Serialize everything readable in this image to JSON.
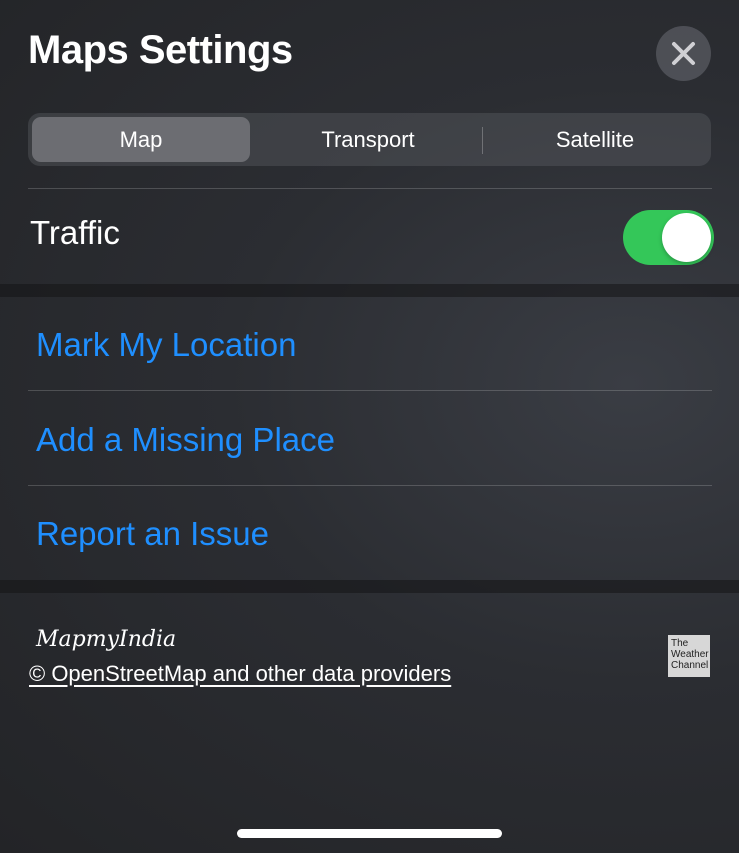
{
  "header": {
    "title": "Maps Settings",
    "close_icon": "close-icon"
  },
  "map_type": {
    "options": [
      "Map",
      "Transport",
      "Satellite"
    ],
    "selected": "Map"
  },
  "traffic": {
    "label": "Traffic",
    "enabled": true,
    "color": "#34c759"
  },
  "actions": [
    "Mark My Location",
    "Add a Missing Place",
    "Report an Issue"
  ],
  "accent_color": "#1f8fff",
  "footer": {
    "mapmyindia": "MapmyIndia",
    "copyright": "© OpenStreetMap and other data providers",
    "weather_logo": [
      "The",
      "Weather",
      "Channel"
    ]
  }
}
